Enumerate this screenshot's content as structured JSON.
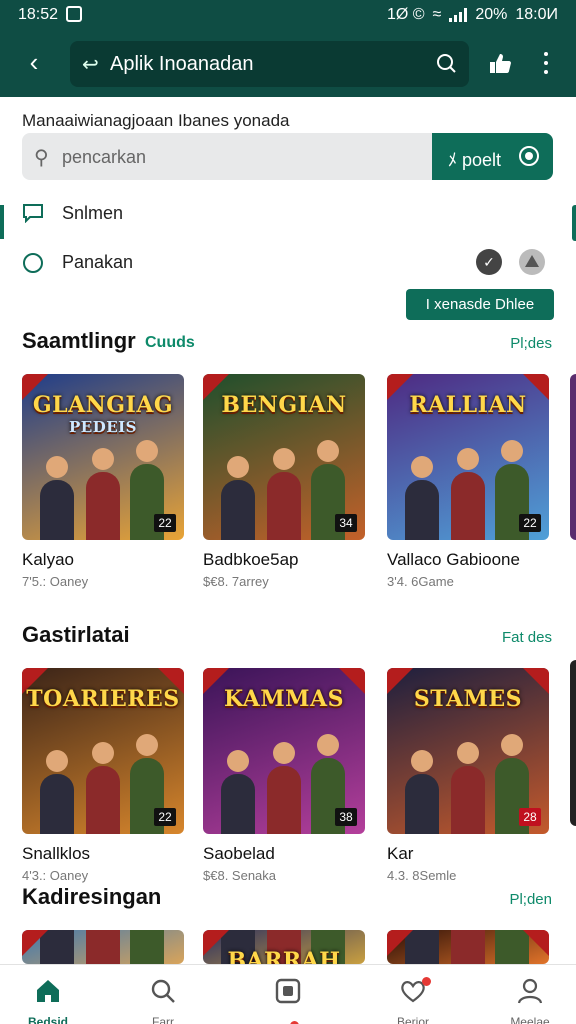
{
  "status": {
    "time": "18:52",
    "right_text": "1Ø ©",
    "battery": "20%",
    "clock": "18:0И"
  },
  "header": {
    "search_text": "Aplik Inoanadan"
  },
  "subtitle": "Manaaiwianagjoaan Ibanes yonada",
  "filter": {
    "placeholder": "pencarkan",
    "button_label": "ﾒ poelt"
  },
  "options": [
    {
      "label": "Snlmen",
      "icon": "chat-icon"
    },
    {
      "label": "Panakan",
      "icon": "radio-icon"
    }
  ],
  "sort_button": "I xenasde Dhlee",
  "sections": [
    {
      "title": "Saamtlingr",
      "tag": "Cuuds",
      "more": "Pl;des",
      "cards": [
        {
          "art_title": "GLANGIAG",
          "art_sub": "PEDEIS",
          "name": "Kalyao",
          "meta": "7'5.: Oaney",
          "badge": "22",
          "badge_red": false,
          "bg1": "#1f3d8a",
          "bg2": "#e9a436"
        },
        {
          "art_title": "BENGIAN",
          "art_sub": "",
          "name": "Badbkoe5ap",
          "meta": "$€8. 7arrey",
          "badge": "34",
          "badge_red": false,
          "bg1": "#1f4f2c",
          "bg2": "#c4612a"
        },
        {
          "art_title": "RALLIAN",
          "art_sub": "",
          "name": "Vallaco Gabioone",
          "meta": "3'4. 6Game",
          "badge": "22",
          "badge_red": false,
          "bg1": "#4e2a82",
          "bg2": "#4fa0d8"
        }
      ]
    },
    {
      "title": "Gastirlatai",
      "tag": "",
      "more": "Fat des",
      "cards": [
        {
          "art_title": "TOARIERES",
          "art_sub": "",
          "name": "Snallklos",
          "meta": "4'3.: Oaney",
          "badge": "22",
          "badge_red": false,
          "bg1": "#3b2418",
          "bg2": "#d7862c"
        },
        {
          "art_title": "KAMMAS",
          "art_sub": "",
          "name": "Saobelad",
          "meta": "$€8. Senaka",
          "badge": "38",
          "badge_red": false,
          "bg1": "#3a1458",
          "bg2": "#b43f9b"
        },
        {
          "art_title": "STAMES",
          "art_sub": "",
          "name": "Kar",
          "meta": "4.3. 8Semle",
          "badge": "28",
          "badge_red": true,
          "bg1": "#1e1f3e",
          "bg2": "#c45a2c"
        }
      ]
    },
    {
      "title": "Kadiresingan",
      "tag": "",
      "more": "Pl;den",
      "cards": [
        {
          "art_title": "",
          "art_sub": "",
          "name": "",
          "meta": "",
          "badge": "",
          "badge_red": false,
          "bg1": "#3f78b0",
          "bg2": "#d9a45a"
        },
        {
          "art_title": "BARRAH",
          "art_sub": "",
          "name": "",
          "meta": "",
          "badge": "",
          "badge_red": false,
          "bg1": "#2b2f60",
          "bg2": "#caa040"
        },
        {
          "art_title": "",
          "art_sub": "",
          "name": "",
          "meta": "",
          "badge": "",
          "badge_red": false,
          "bg1": "#2a0f08",
          "bg2": "#e2742a"
        }
      ]
    }
  ],
  "nav": [
    {
      "label": "Bedsid",
      "icon": "home-icon",
      "active": true
    },
    {
      "label": "Farr",
      "icon": "search-icon",
      "active": false
    },
    {
      "label": "",
      "icon": "square-icon",
      "active": false
    },
    {
      "label": "Berior",
      "icon": "heart-icon",
      "active": false
    },
    {
      "label": "Meelae",
      "icon": "profile-icon",
      "active": false
    }
  ]
}
